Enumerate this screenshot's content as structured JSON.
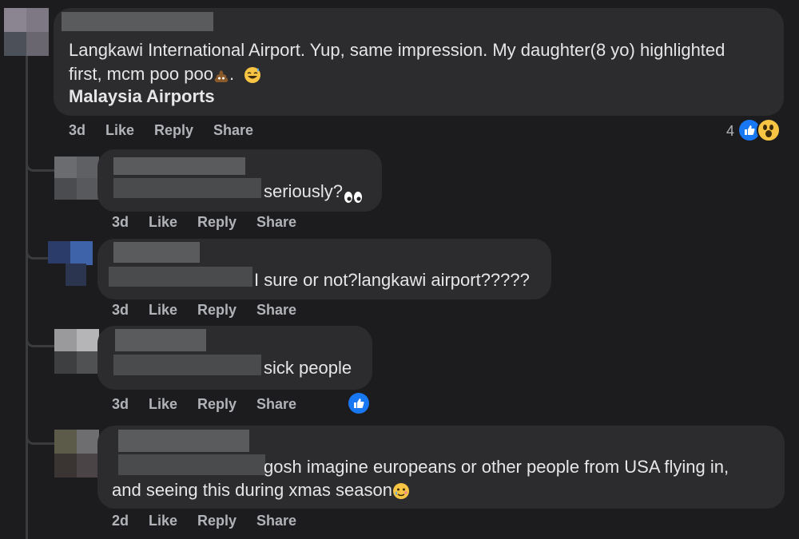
{
  "comments": [
    {
      "line1": "Langkawi International Airport. Yup, same impression. My daughter(8 yo) highlighted",
      "line2": "first, mcm poo poo",
      "line2_after": ".",
      "tag": "Malaysia Airports",
      "time": "3d",
      "like": "Like",
      "reply": "Reply",
      "share": "Share",
      "reaction_count": "4"
    },
    {
      "text": "seriously?",
      "time": "3d",
      "like": "Like",
      "reply": "Reply",
      "share": "Share"
    },
    {
      "text": "I sure or not?langkawi airport?????",
      "time": "3d",
      "like": "Like",
      "reply": "Reply",
      "share": "Share"
    },
    {
      "text": "sick people",
      "time": "3d",
      "like": "Like",
      "reply": "Reply",
      "share": "Share"
    },
    {
      "line1": "gosh imagine europeans or other people from USA flying in,",
      "line2": "and seeing this during xmas season",
      "time": "2d",
      "like": "Like",
      "reply": "Reply",
      "share": "Share"
    }
  ],
  "icons": {
    "like_reaction": "thumbs-up-icon",
    "wow_reaction": "wow-face-icon",
    "poo": "poo-emoji-icon",
    "sweat_smile": "sweat-smile-emoji-icon",
    "eyes": "eyes-emoji-icon",
    "tear_face": "tear-face-emoji-icon"
  },
  "colors": {
    "background": "#1c1c1e",
    "bubble": "#2c2c2e",
    "like_blue": "#1877f2",
    "action_text": "#b0b3b8"
  }
}
